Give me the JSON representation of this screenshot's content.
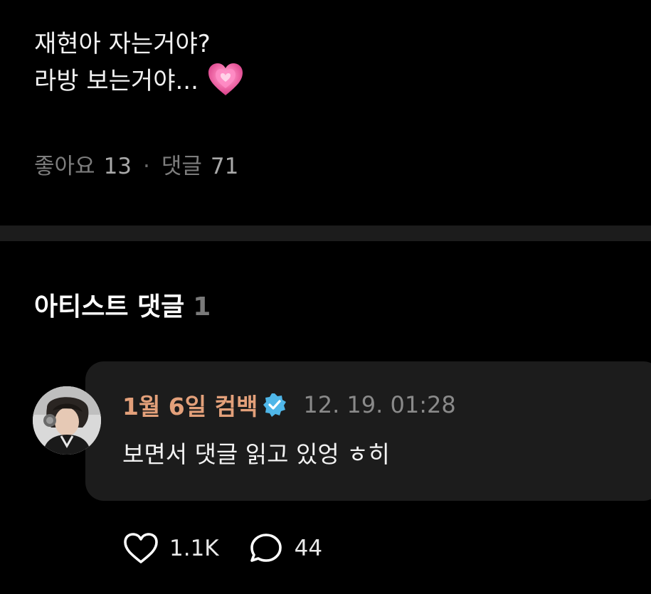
{
  "post": {
    "lines": [
      "재현아 자는거야?",
      "라방 보는거야..."
    ],
    "emoji": "growing-heart-emoji",
    "likes_label": "좋아요",
    "likes_count": "13",
    "separator": "·",
    "comments_label": "댓글",
    "comments_count": "71"
  },
  "artist_section": {
    "title": "아티스트 댓글",
    "count": "1"
  },
  "comment": {
    "author": "1월 6일 컴백",
    "verified_icon": "verified-badge-icon",
    "timestamp": "12. 19. 01:28",
    "text": "보면서 댓글 읽고 있엉 ㅎ히",
    "likes": "1.1K",
    "replies": "44"
  },
  "colors": {
    "background": "#000000",
    "bubble": "#1c1c1c",
    "author_accent": "#e3a07a",
    "verified_badge": "#4fb6e8",
    "muted_text": "#7d7d7d"
  }
}
